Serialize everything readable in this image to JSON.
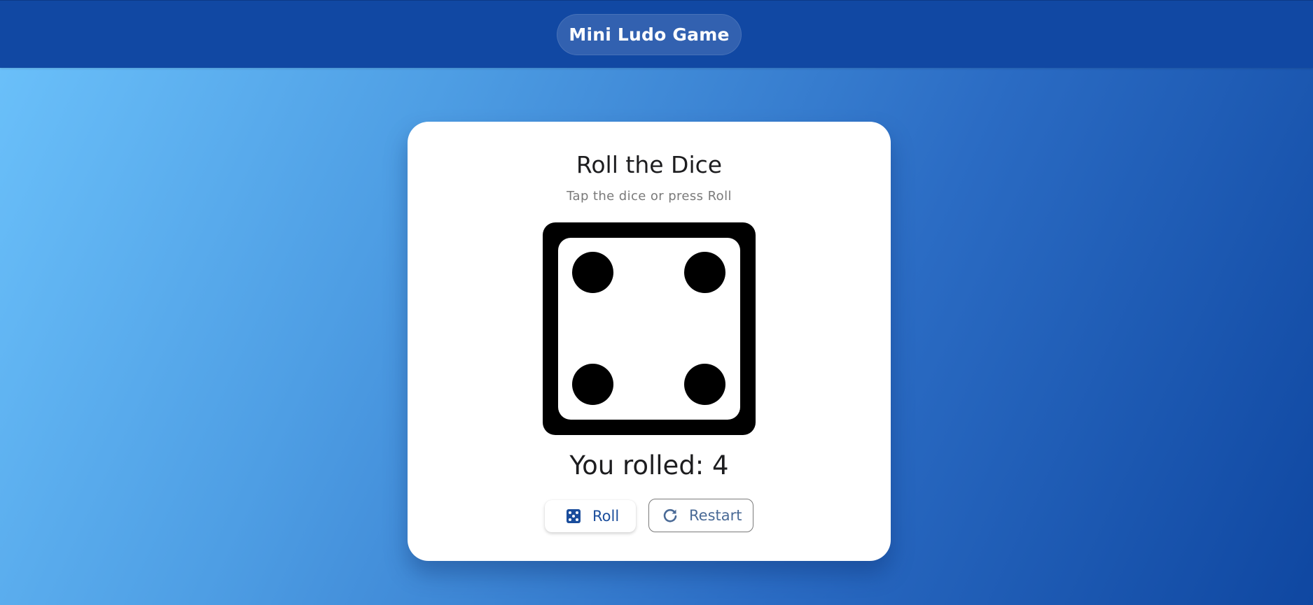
{
  "app_bar": {
    "title": "Mini Ludo Game"
  },
  "card": {
    "title": "Roll the Dice",
    "subtitle": "Tap the dice or press Roll",
    "dice_value": 4,
    "result_text": "You rolled: 4"
  },
  "buttons": {
    "roll_label": "Roll",
    "roll_icon": "dice-icon",
    "restart_label": "Restart",
    "restart_icon": "refresh-icon"
  },
  "colors": {
    "app_bar": "#1148a3",
    "accent": "#1a4d9c",
    "dice": "#000000",
    "card": "#ffffff"
  }
}
